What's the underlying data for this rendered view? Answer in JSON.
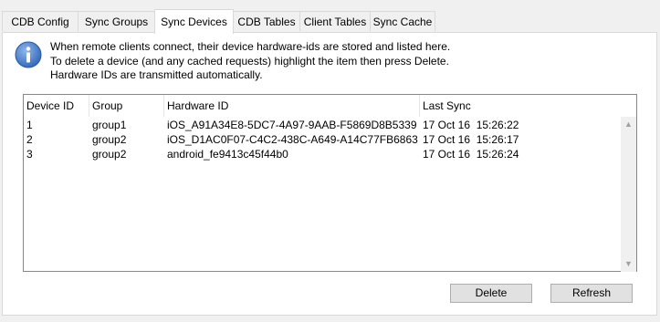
{
  "tabs": [
    {
      "label": "CDB Config",
      "active": false
    },
    {
      "label": "Sync Groups",
      "active": false
    },
    {
      "label": "Sync Devices",
      "active": true
    },
    {
      "label": "CDB Tables",
      "active": false
    },
    {
      "label": "Client Tables",
      "active": false
    },
    {
      "label": "Sync Cache",
      "active": false
    }
  ],
  "info": {
    "icon": "info-icon",
    "line1": "When remote clients connect, their device hardware-ids are stored and listed here.",
    "line2": "To delete a device (and any cached requests) highlight the item then press Delete.",
    "line3": "Hardware IDs are transmitted automatically."
  },
  "list": {
    "columns": [
      "Device ID",
      "Group",
      "Hardware ID",
      "Last Sync"
    ],
    "rows": [
      {
        "device_id": "1",
        "group": "group1",
        "hardware_id": "iOS_A91A34E8-5DC7-4A97-9AAB-F5869D8B5339",
        "last_sync": "17 Oct 16  15:26:22"
      },
      {
        "device_id": "2",
        "group": "group2",
        "hardware_id": "iOS_D1AC0F07-C4C2-438C-A649-A14C77FB6863",
        "last_sync": "17 Oct 16  15:26:17"
      },
      {
        "device_id": "3",
        "group": "group2",
        "hardware_id": "android_fe9413c45f44b0",
        "last_sync": "17 Oct 16  15:26:24"
      }
    ]
  },
  "buttons": {
    "delete": "Delete",
    "refresh": "Refresh"
  },
  "colors": {
    "info_blue": "#3a78c8",
    "border": "#828790"
  }
}
